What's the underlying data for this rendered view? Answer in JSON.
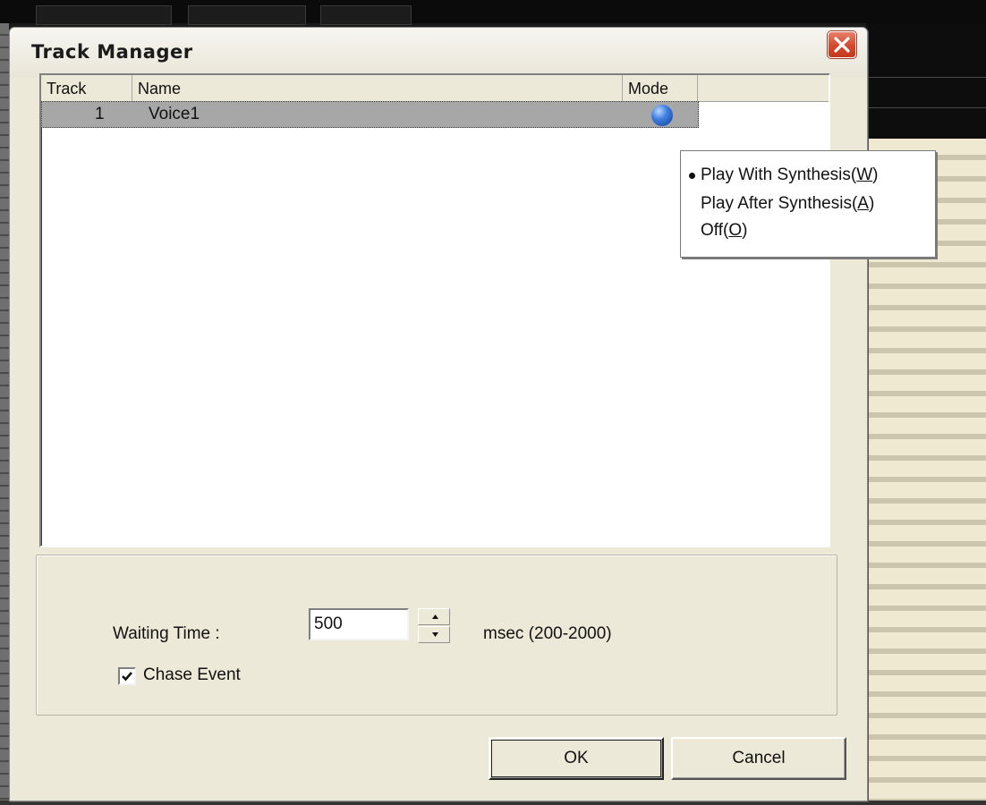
{
  "window": {
    "title": "Track Manager"
  },
  "track_list": {
    "columns": [
      "Track",
      "Name",
      "Mode"
    ],
    "rows": [
      {
        "track": "1",
        "name": "Voice1",
        "mode_icon": "blue-ball-icon"
      }
    ]
  },
  "mode_menu": {
    "items": [
      {
        "pre": "Play With Synthesis(",
        "key": "W",
        "post": ")",
        "checked": true
      },
      {
        "pre": "Play After Synthesis(",
        "key": "A",
        "post": ")",
        "checked": false
      },
      {
        "pre": "Off(",
        "key": "O",
        "post": ")",
        "checked": false
      }
    ]
  },
  "settings": {
    "waiting_time_label": "Waiting Time :",
    "waiting_time_value": "500",
    "waiting_time_unit": "msec (200-2000)",
    "chase_event_label": "Chase Event",
    "chase_event_checked": true
  },
  "buttons": {
    "ok": "OK",
    "cancel": "Cancel"
  },
  "colors": {
    "dialog_bg": "#ece9d8",
    "selection": "#a7a7a7",
    "close_button": "#d2492c",
    "mode_icon": "#3f7fe0"
  }
}
